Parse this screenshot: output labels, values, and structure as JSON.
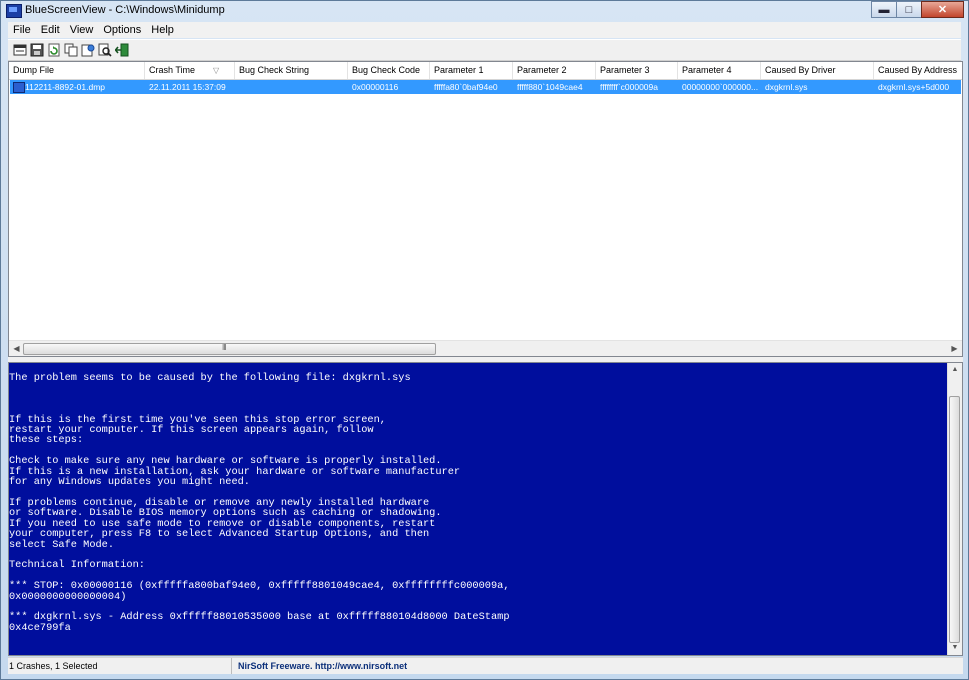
{
  "window": {
    "title": "BlueScreenView  -  C:\\Windows\\Minidump"
  },
  "window_buttons": {
    "minimize": "▬",
    "maximize": "□",
    "close": "✕"
  },
  "menu": [
    "File",
    "Edit",
    "View",
    "Options",
    "Help"
  ],
  "toolbar": {
    "icons": [
      "properties-icon",
      "save-icon",
      "refresh-icon",
      "copy-icon",
      "html-report-icon",
      "find-icon",
      "exit-icon"
    ]
  },
  "table": {
    "columns": [
      "Dump File",
      "Crash Time",
      "Bug Check String",
      "Bug Check Code",
      "Parameter 1",
      "Parameter 2",
      "Parameter 3",
      "Parameter 4",
      "Caused By Driver",
      "Caused By Address"
    ],
    "sort_indicator": "▽",
    "rows": [
      [
        "112211-8892-01.dmp",
        "22.11.2011 15:37:09",
        "",
        "0x00000116",
        "fffffa80`0baf94e0",
        "fffff880`1049cae4",
        "ffffffff`c000009a",
        "00000000`000000...",
        "dxgkrnl.sys",
        "dxgkrnl.sys+5d000"
      ]
    ],
    "scroll_grip": "III"
  },
  "bsod": {
    "text": "The problem seems to be caused by the following file: dxgkrnl.sys\n\n\n\nIf this is the first time you've seen this stop error screen,\nrestart your computer. If this screen appears again, follow\nthese steps:\n\nCheck to make sure any new hardware or software is properly installed.\nIf this is a new installation, ask your hardware or software manufacturer\nfor any Windows updates you might need.\n\nIf problems continue, disable or remove any newly installed hardware\nor software. Disable BIOS memory options such as caching or shadowing.\nIf you need to use safe mode to remove or disable components, restart\nyour computer, press F8 to select Advanced Startup Options, and then\nselect Safe Mode.\n\nTechnical Information:\n\n*** STOP: 0x00000116 (0xfffffa800baf94e0, 0xfffff8801049cae4, 0xffffffffc000009a,\n0x0000000000000004)\n\n*** dxgkrnl.sys - Address 0xfffff88010535000 base at 0xfffff880104d8000 DateStamp\n0x4ce799fa",
    "background": "#000e9d"
  },
  "status": {
    "summary": "1 Crashes, 1 Selected",
    "link": "NirSoft Freeware.  http://www.nirsoft.net"
  },
  "colors": {
    "selection": "#3399ff",
    "bsod_bg": "#000e9d",
    "bsod_text": "#ffffff"
  }
}
